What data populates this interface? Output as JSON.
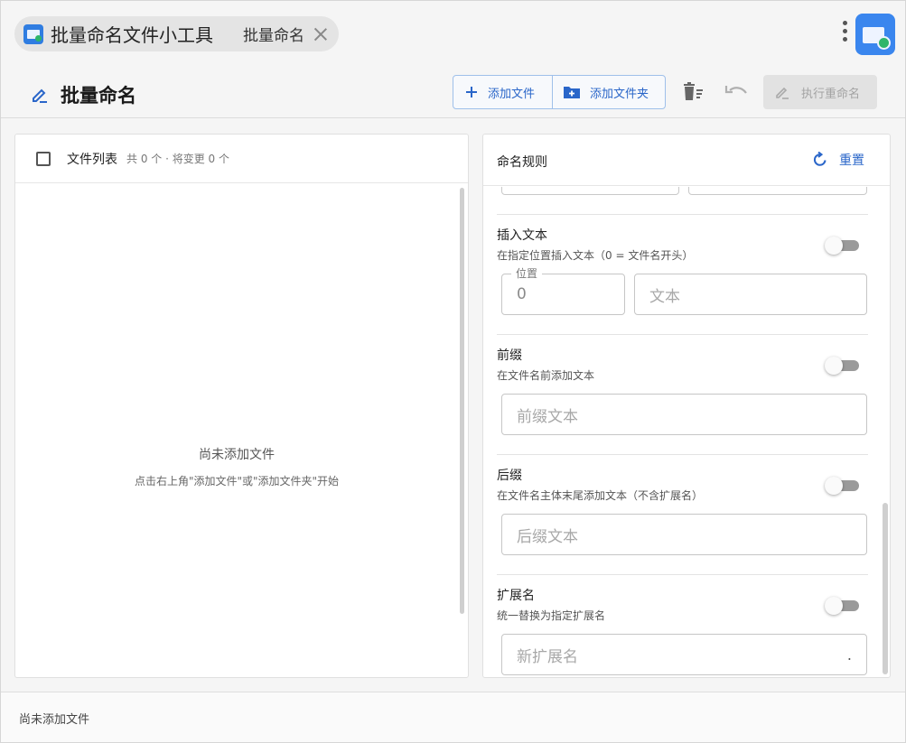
{
  "titlebar": {
    "app_title": "批量命名文件小工具",
    "tab_label": "批量命名"
  },
  "toolbar": {
    "page_title": "批量命名",
    "add_file_label": "添加文件",
    "add_folder_label": "添加文件夹",
    "execute_label": "执行重命名"
  },
  "file_list": {
    "title": "文件列表",
    "count_text": "共 0 个 · 将变更 0 个",
    "empty_title": "尚未添加文件",
    "empty_hint": "点击右上角\"添加文件\"或\"添加文件夹\"开始"
  },
  "rules": {
    "title": "命名规则",
    "reset_label": "重置",
    "insert": {
      "title": "插入文本",
      "desc": "在指定位置插入文本（0 = 文件名开头）",
      "enabled": false,
      "position_label": "位置",
      "position_value": "0",
      "text_placeholder": "文本"
    },
    "prefix": {
      "title": "前缀",
      "desc": "在文件名前添加文本",
      "enabled": false,
      "placeholder": "前缀文本"
    },
    "suffix": {
      "title": "后缀",
      "desc": "在文件名主体末尾添加文本（不含扩展名）",
      "enabled": false,
      "placeholder": "后缀文本"
    },
    "extension": {
      "title": "扩展名",
      "desc": "统一替换为指定扩展名",
      "enabled": false,
      "placeholder": "新扩展名",
      "dot": "."
    }
  },
  "status": {
    "text": "尚未添加文件"
  },
  "colors": {
    "accent": "#2a66c9",
    "toggle_off": "#9a9a9a",
    "app_icon": "#3a86ee"
  }
}
